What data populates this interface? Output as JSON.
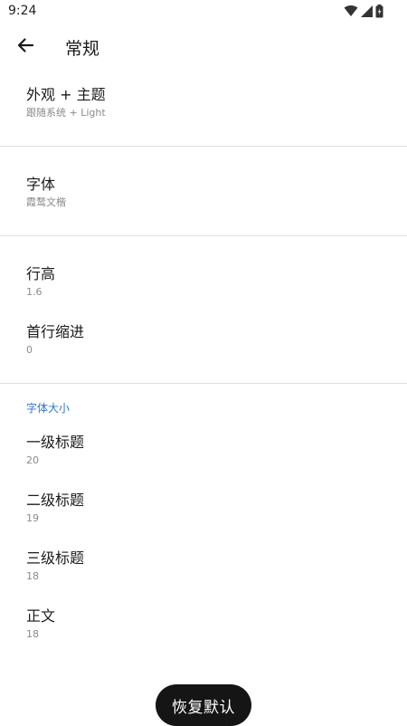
{
  "status_bar": {
    "time": "9:24",
    "icons": [
      "wifi-icon",
      "signal-icon",
      "battery-icon"
    ]
  },
  "header": {
    "back_icon": "arrow-left-icon",
    "title": "常规"
  },
  "settings": {
    "appearance": {
      "title": "外观 + 主题",
      "value": "跟随系统 + Light"
    },
    "font": {
      "title": "字体",
      "value": "霞鹜文楷"
    },
    "line_height": {
      "title": "行高",
      "value": "1.6"
    },
    "first_line_indent": {
      "title": "首行缩进",
      "value": "0"
    }
  },
  "font_size_section": {
    "header": "字体大小",
    "items": [
      {
        "title": "一级标题",
        "value": "20"
      },
      {
        "title": "二级标题",
        "value": "19"
      },
      {
        "title": "三级标题",
        "value": "18"
      },
      {
        "title": "正文",
        "value": "18"
      }
    ]
  },
  "actions": {
    "restore_defaults": "恢复默认"
  },
  "colors": {
    "accent": "#2f74d8",
    "button_bg": "#151515",
    "divider": "#e0e0e0",
    "secondary_text": "#8a8a8a"
  }
}
